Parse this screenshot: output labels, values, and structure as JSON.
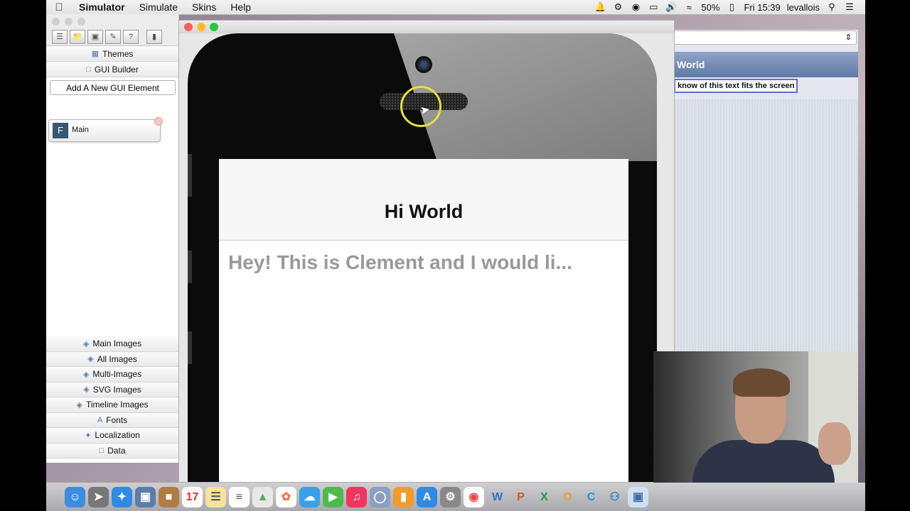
{
  "menubar": {
    "app_name": "Simulator",
    "items": [
      "Simulate",
      "Skins",
      "Help"
    ],
    "battery": "50%",
    "clock": "Fri 15:39",
    "user": "levallois"
  },
  "designer": {
    "themes": "Themes",
    "gui_builder": "GUI Builder",
    "add_element": "Add A New GUI Element",
    "form_item": "Main",
    "form_icon": "F",
    "bottom_items": [
      "Main Images",
      "All Images",
      "Multi-Images",
      "SVG Images",
      "Timeline Images",
      "Fonts",
      "Localization",
      "Data"
    ]
  },
  "properties": {
    "header": "World",
    "field_text": "know of this text fits the screen"
  },
  "simulator": {
    "form_title": "Hi World",
    "label_text": "Hey! This is Clement and I would li..."
  },
  "colors": {
    "header_blue": "#6f87b3",
    "field_border": "#5a6fd0",
    "cursor_highlight": "#e4e23a"
  }
}
